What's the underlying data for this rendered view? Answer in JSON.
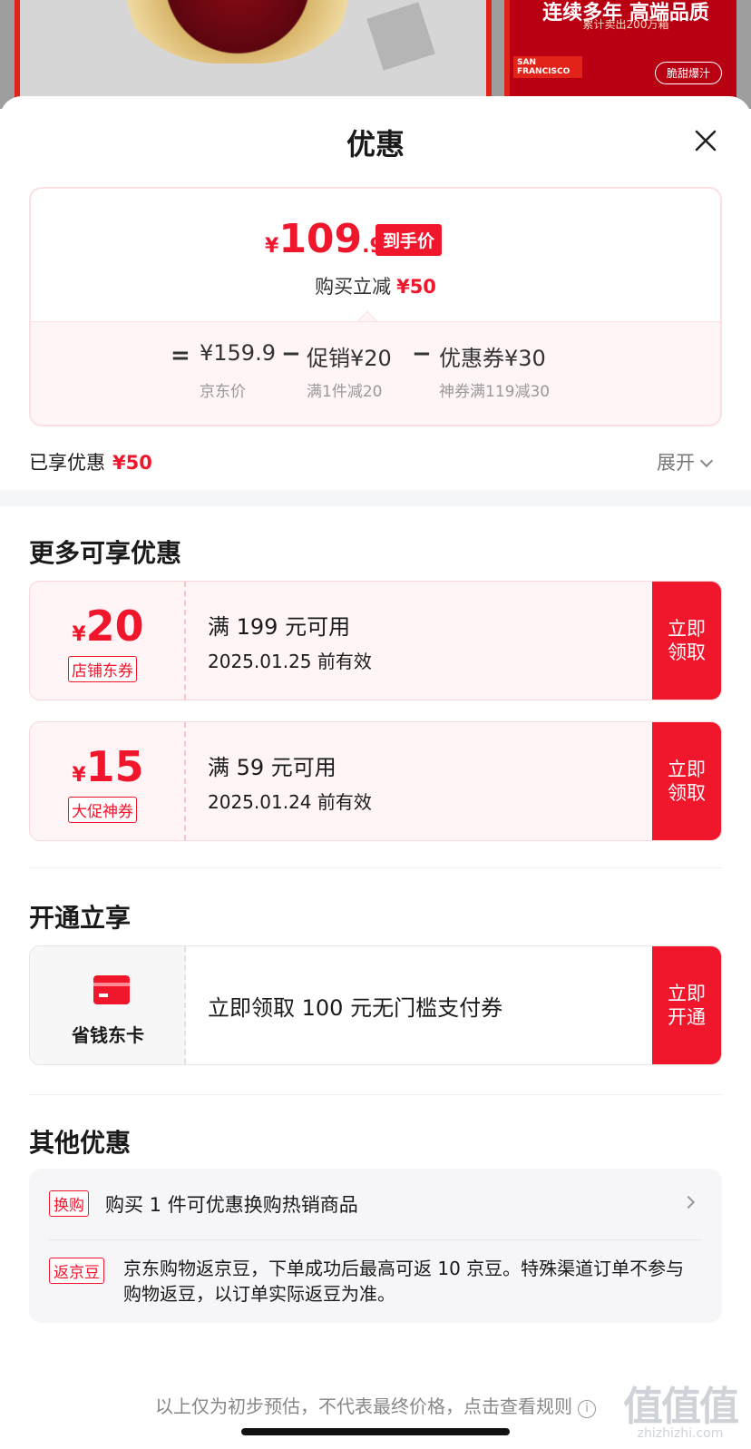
{
  "background": {
    "right_title": "连续多年 高端品质",
    "right_subtitle": "累计卖出200万箱",
    "logo_text": "SAN FRANCISCO",
    "badge": "脆甜爆汁"
  },
  "sheet": {
    "title": "优惠"
  },
  "price_card": {
    "yen": "¥",
    "price_int": "109",
    "price_dec": ".9",
    "price_tag": "到手价",
    "reduce_label": "购买立减",
    "reduce_value": "¥50",
    "eq": "=",
    "jd_price": "¥159.9",
    "jd_price_label": "京东价",
    "minus": "−",
    "promo": "促销¥20",
    "promo_label": "满1件减20",
    "coupon": "优惠券¥30",
    "coupon_label": "神券满119减30"
  },
  "enjoyed": {
    "label": "已享优惠",
    "value": "¥50",
    "expand": "展开"
  },
  "more": {
    "title": "更多可享优惠",
    "coupons": [
      {
        "yen": "¥",
        "amount": "20",
        "type": "店铺东券",
        "condition": "满 199 元可用",
        "expiry": "2025.01.25 前有效",
        "button": "立即领取"
      },
      {
        "yen": "¥",
        "amount": "15",
        "type": "大促神券",
        "condition": "满 59 元可用",
        "expiry": "2025.01.24 前有效",
        "button": "立即领取"
      }
    ]
  },
  "open": {
    "title": "开通立享",
    "card_name": "省钱东卡",
    "desc": "立即领取 100 元无门槛支付券",
    "button": "立即开通"
  },
  "others": {
    "title": "其他优惠",
    "row1_tag": "换购",
    "row1_text": "购买 1 件可优惠换购热销商品",
    "row2_tag": "返京豆",
    "row2_text": "京东购物返京豆，下单成功后最高可返 10 京豆。特殊渠道订单不参与购物返豆，以订单实际返豆为准。"
  },
  "footer": {
    "note": "以上仅为初步预估，不代表最终价格，点击查看规则",
    "info": "i"
  },
  "watermark": {
    "big": "值值值",
    "small": "zhizhizhi.com"
  },
  "colors": {
    "accent": "#f0162c",
    "light_pink": "#fff5f6"
  }
}
